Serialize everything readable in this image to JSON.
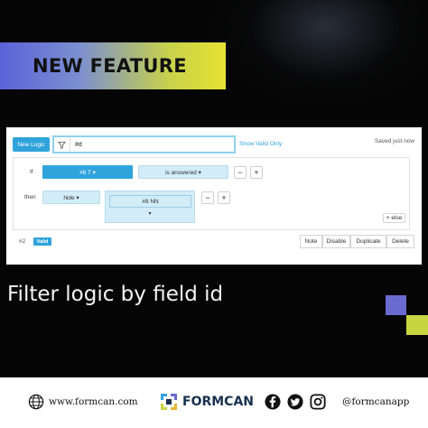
{
  "banner": {
    "title": "NEW FEATURE"
  },
  "toolbar": {
    "new_logic_label": "New Logic",
    "filter_value": "#d",
    "show_valid_label": "Show Valid Only",
    "saved_status": "Saved just now"
  },
  "rule": {
    "if_label": "If",
    "field_value": "#6 T ▾",
    "operator_value": "is answered ▾",
    "then_label": "then",
    "action_value": "hide ▾",
    "target_value": "#8 NN",
    "target_caret": "▾",
    "minus": "−",
    "plus": "+",
    "else_label": "+ else"
  },
  "rule_footer": {
    "number": "#2",
    "status_badge": "Valid",
    "actions": [
      "Note",
      "Disable",
      "Duplicate",
      "Delete"
    ]
  },
  "headline": "Filter logic by field id",
  "contact": {
    "website": "www.formcan.com",
    "brand": "FORMCAN",
    "handle": "@formcanapp"
  },
  "colors": {
    "accent_blue": "#2fa3db",
    "light_blue": "#d2ecf8",
    "deco_purple": "#6a6ad0",
    "deco_lime": "#c7d640",
    "brand_navy": "#1a3050"
  },
  "icons": [
    "filter-icon",
    "globe-icon",
    "formcan-logo-icon",
    "facebook-icon",
    "twitter-icon",
    "instagram-icon"
  ]
}
